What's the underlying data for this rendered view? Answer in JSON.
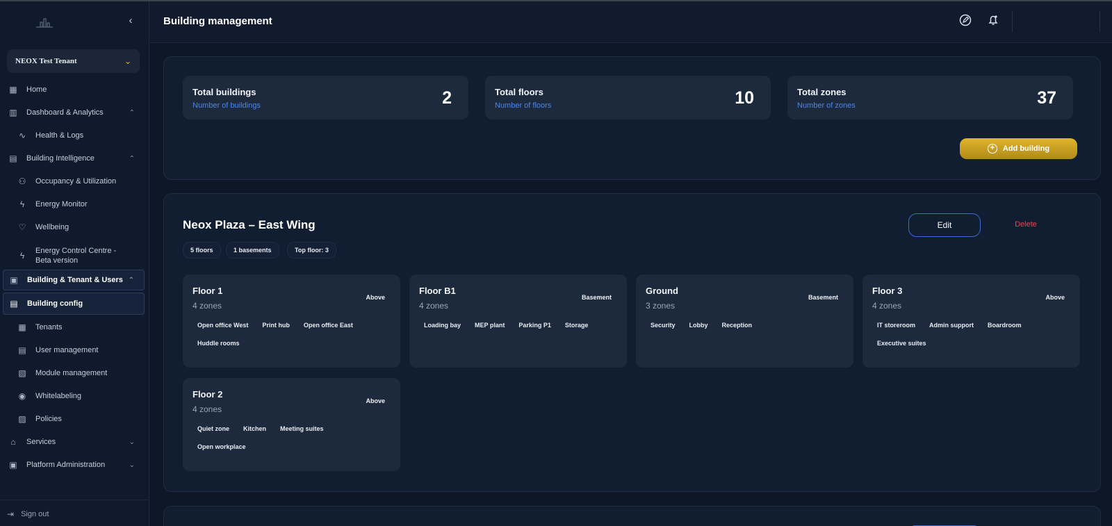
{
  "sidebar": {
    "logo_icon": "building-logo-icon",
    "tenant": "NEOX Test Tenant",
    "items": [
      {
        "label": "Home",
        "icon": "grid-icon"
      },
      {
        "label": "Dashboard & Analytics",
        "icon": "chart-icon"
      },
      {
        "label": "Health & Logs",
        "icon": "pulse-icon"
      },
      {
        "label": "Building Intelligence",
        "icon": "building-icon"
      },
      {
        "label": "Occupancy & Utilization",
        "icon": "users-icon"
      },
      {
        "label": "Energy Monitor",
        "icon": "bolt-icon"
      },
      {
        "label": "Wellbeing",
        "icon": "heart-icon"
      },
      {
        "label": "Energy Control Centre -",
        "label2": "Beta version",
        "icon": "bolt-icon"
      },
      {
        "label": "Building & Tenant & Users",
        "icon": "building-users-icon"
      },
      {
        "label": "Building config",
        "icon": "building-config-icon"
      },
      {
        "label": "Tenants",
        "icon": "tenants-icon"
      },
      {
        "label": "User management",
        "icon": "user-icon"
      },
      {
        "label": "Module management",
        "icon": "module-icon"
      },
      {
        "label": "Whitelabeling",
        "icon": "palette-icon"
      },
      {
        "label": "Policies",
        "icon": "policy-icon"
      },
      {
        "label": "Services",
        "icon": "services-icon"
      },
      {
        "label": "Platform Administration",
        "icon": "admin-icon"
      }
    ],
    "signout": "Sign out"
  },
  "header": {
    "title": "Building management",
    "icons": [
      "edit-icon",
      "bell-icon"
    ]
  },
  "stats": [
    {
      "label": "Total buildings",
      "sub": "Number of buildings",
      "value": "2"
    },
    {
      "label": "Total floors",
      "sub": "Number of floors",
      "value": "10"
    },
    {
      "label": "Total zones",
      "sub": "Number of zones",
      "value": "37"
    }
  ],
  "add_building": "Add building",
  "building": {
    "name": "Neox Plaza – East Wing",
    "edit": "Edit",
    "delete": "Delete",
    "pills": [
      "5 floors",
      "1 basements",
      "Top floor: 3"
    ],
    "floors": [
      {
        "name": "Floor 1",
        "zones": "4 zones",
        "type": "Above",
        "tags": [
          "Open office West",
          "Print hub",
          "Open office East",
          "Huddle rooms"
        ]
      },
      {
        "name": "Floor B1",
        "zones": "4 zones",
        "type": "Basement",
        "tags": [
          "Loading bay",
          "MEP plant",
          "Parking P1",
          "Storage"
        ]
      },
      {
        "name": "Ground",
        "zones": "3 zones",
        "type": "Basement",
        "tags": [
          "Security",
          "Lobby",
          "Reception"
        ]
      },
      {
        "name": "Floor 3",
        "zones": "4 zones",
        "type": "Above",
        "tags": [
          "IT storeroom",
          "Admin support",
          "Boardroom",
          "Executive suites"
        ]
      },
      {
        "name": "Floor 2",
        "zones": "4 zones",
        "type": "Above",
        "tags": [
          "Quiet zone",
          "Kitchen",
          "Meeting suites",
          "Open workplace"
        ]
      }
    ]
  },
  "colors": {
    "accent": "#e0b52f",
    "link": "#4d86e8",
    "danger": "#e8454a",
    "background": "#0d1728"
  }
}
